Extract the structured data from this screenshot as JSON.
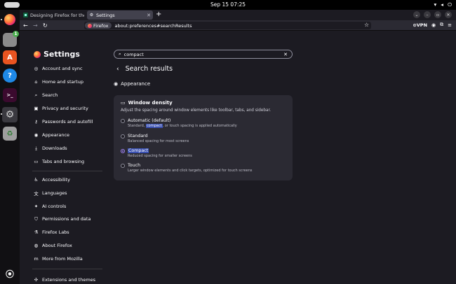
{
  "system": {
    "clock": "Sep 15  07:25"
  },
  "tabs": [
    {
      "title": "Designing Firefox for the",
      "active": false
    },
    {
      "title": "Settings",
      "active": true
    }
  ],
  "navbar": {
    "identity": "Firefox",
    "url": "about:preferences#searchResults",
    "vpn_label": "VPN"
  },
  "dock": {
    "files_badge": "1"
  },
  "sidebar": {
    "title": "Settings",
    "items": [
      {
        "label": "Account and sync",
        "icon": "account-icon"
      },
      {
        "label": "Home and startup",
        "icon": "home-icon"
      },
      {
        "label": "Search",
        "icon": "search-icon"
      },
      {
        "label": "Privacy and security",
        "icon": "lock-icon"
      },
      {
        "label": "Passwords and autofill",
        "icon": "key-icon"
      },
      {
        "label": "Appearance",
        "icon": "eye-icon"
      },
      {
        "label": "Downloads",
        "icon": "download-icon"
      },
      {
        "label": "Tabs and browsing",
        "icon": "tabs-icon"
      },
      {
        "label": "Accessibility",
        "icon": "accessibility-icon"
      },
      {
        "label": "Languages",
        "icon": "translate-icon"
      },
      {
        "label": "AI controls",
        "icon": "sparkle-icon"
      },
      {
        "label": "Permissions and data",
        "icon": "shield-icon"
      },
      {
        "label": "Firefox Labs",
        "icon": "flask-icon"
      },
      {
        "label": "About Firefox",
        "icon": "firefox-icon"
      },
      {
        "label": "More from Mozilla",
        "icon": "mozilla-icon"
      },
      {
        "label": "Extensions and themes",
        "icon": "puzzle-icon"
      }
    ]
  },
  "search": {
    "value": "compact"
  },
  "results": {
    "heading": "Search results",
    "section": "Appearance"
  },
  "window_density": {
    "title": "Window density",
    "description": "Adjust the spacing around window elements like toolbar, tabs, and sidebar.",
    "options": [
      {
        "label": "Automatic (default)",
        "sub_before": "Standard, ",
        "sub_highlight": "compact",
        "sub_after": ", or touch spacing is applied automatically",
        "checked": false
      },
      {
        "label": "Standard",
        "sub": "Balanced spacing for most screens",
        "checked": false
      },
      {
        "label": "Compact",
        "sub": "Reduced spacing for smaller screens",
        "checked": true
      },
      {
        "label": "Touch",
        "sub": "Larger window elements and click targets, optimized for touch screens",
        "checked": false
      }
    ]
  }
}
